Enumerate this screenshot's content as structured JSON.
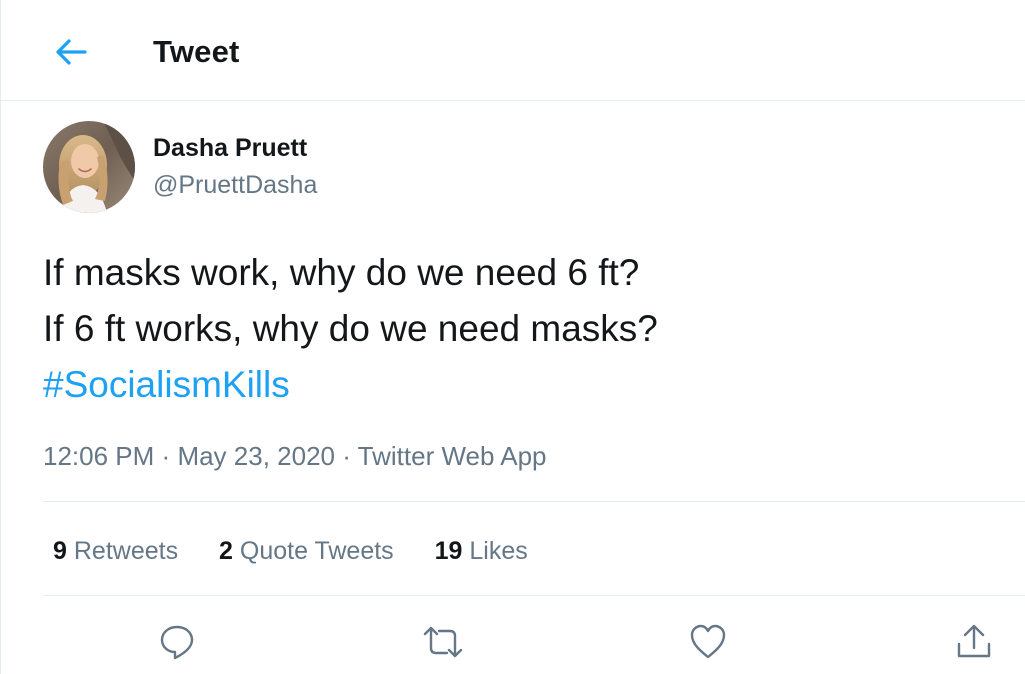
{
  "header": {
    "title": "Tweet",
    "back_icon": "arrow-left-icon"
  },
  "author": {
    "name": "Dasha Pruett",
    "handle": "@PruettDasha"
  },
  "tweet": {
    "lines": [
      "If masks work, why do we need 6 ft?",
      "If 6 ft works, why do we need masks?"
    ],
    "hashtag": "#SocialismKills"
  },
  "meta": {
    "time": "12:06 PM",
    "separator": "·",
    "date": "May 23, 2020",
    "source": "Twitter Web App"
  },
  "stats": {
    "retweets": {
      "count": "9",
      "label": "Retweets"
    },
    "quotes": {
      "count": "2",
      "label": "Quote Tweets"
    },
    "likes": {
      "count": "19",
      "label": "Likes"
    }
  },
  "actions": [
    "reply-icon",
    "retweet-icon",
    "like-icon",
    "share-icon"
  ],
  "colors": {
    "accent": "#1da1f2",
    "text": "#14171a",
    "secondary": "#657786",
    "divider": "#e6ecf0"
  }
}
